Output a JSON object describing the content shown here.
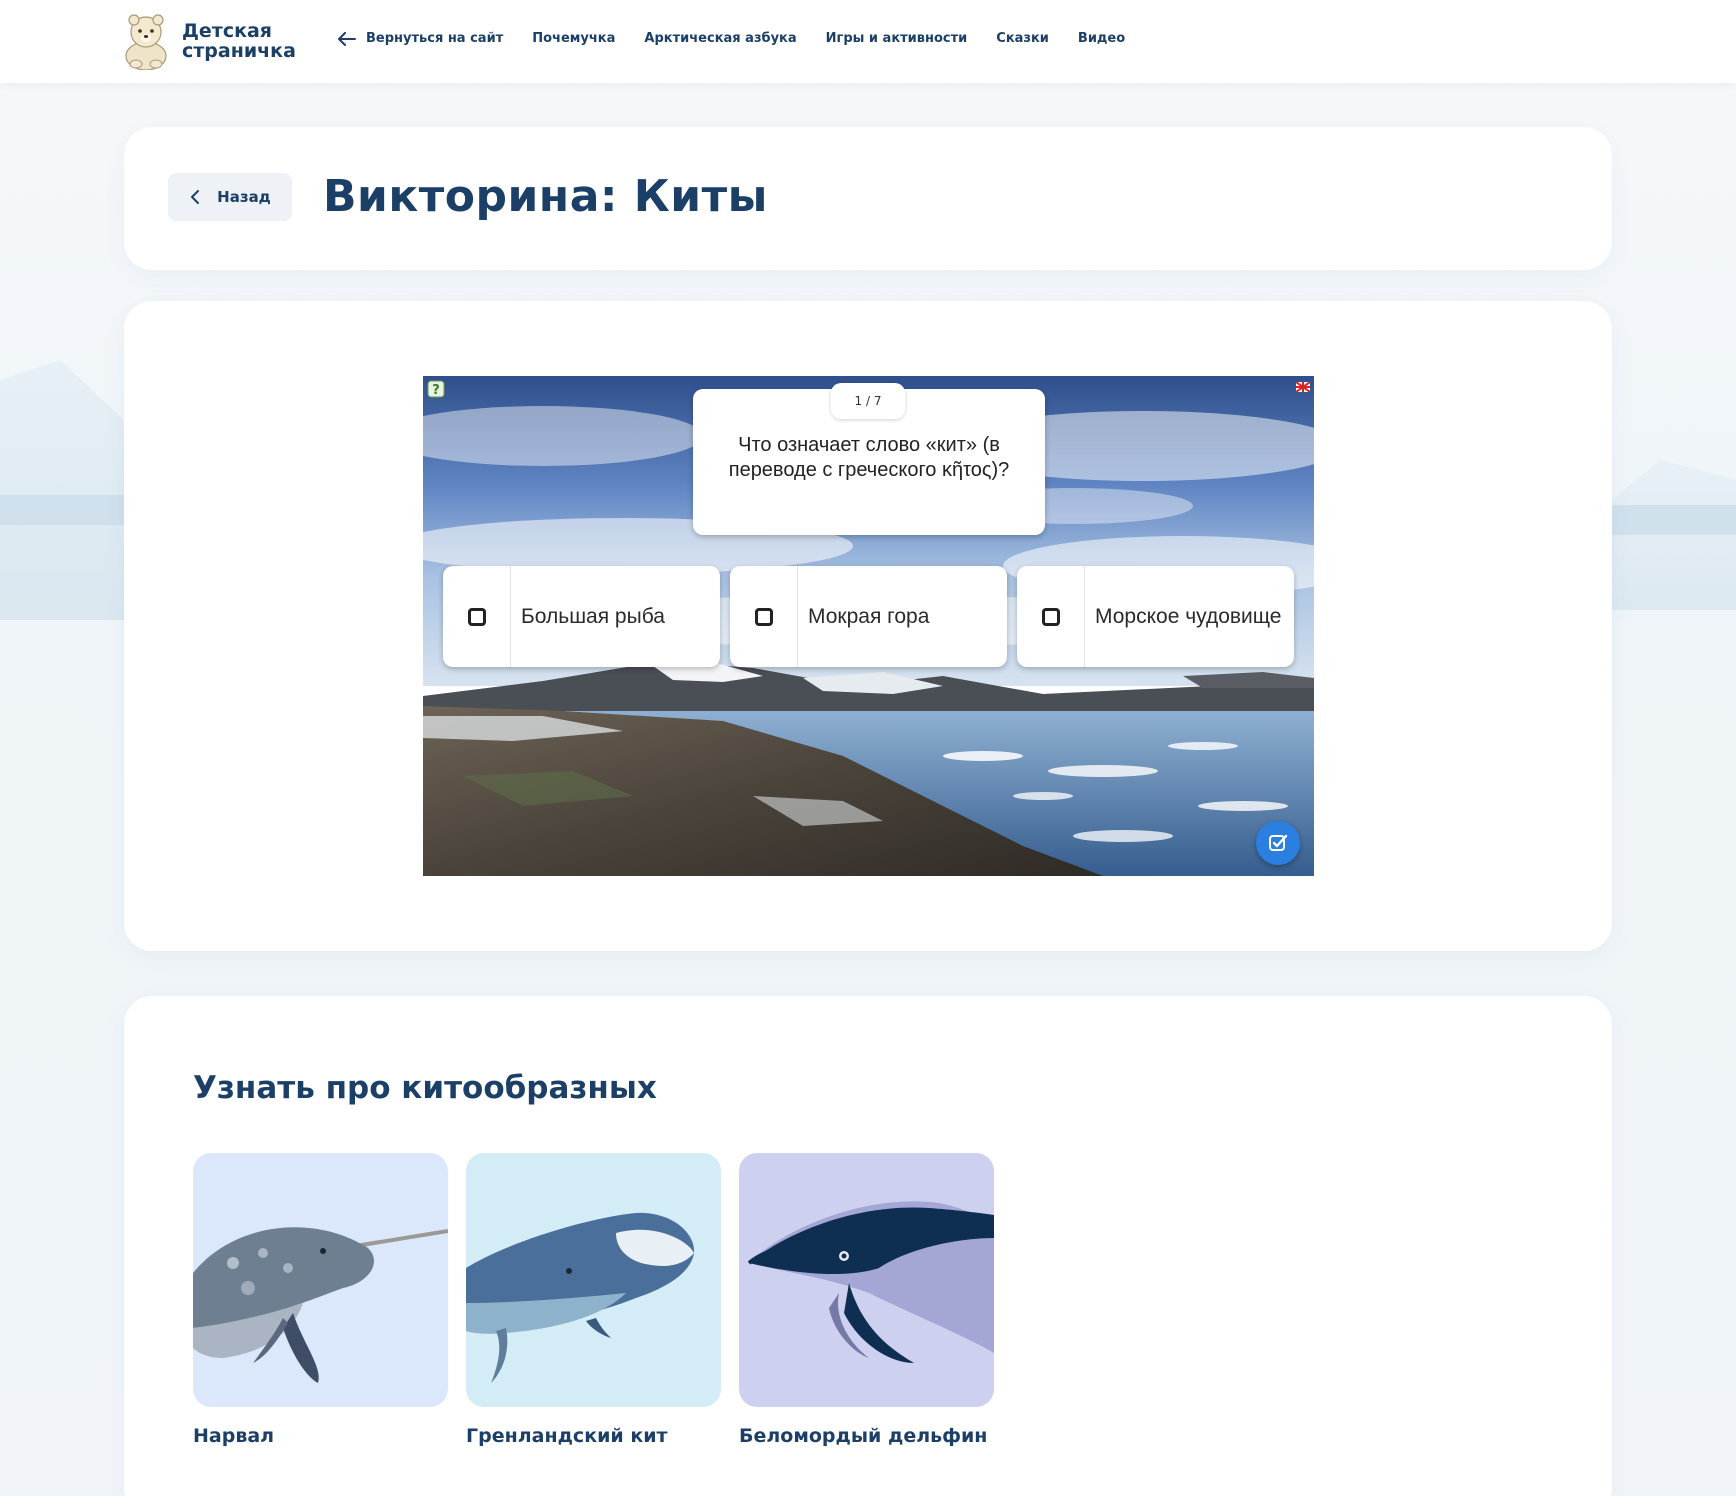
{
  "header": {
    "logo_line1": "Детская",
    "logo_line2": "страничка",
    "nav": [
      {
        "label": "Вернуться на сайт"
      },
      {
        "label": "Почемучка"
      },
      {
        "label": "Арктическая азбука"
      },
      {
        "label": "Игры и активности"
      },
      {
        "label": "Сказки"
      },
      {
        "label": "Видео"
      }
    ]
  },
  "title_card": {
    "back_label": "Назад",
    "title": "Викторина: Киты"
  },
  "quiz": {
    "counter": "1 / 7",
    "question": "Что означает слово «кит» (в переводе с греческого κῆτος)?",
    "answers": [
      {
        "label": "Большая рыба"
      },
      {
        "label": "Мокрая гора"
      },
      {
        "label": "Морское чудовище"
      }
    ]
  },
  "learn": {
    "title": "Узнать про китообразных",
    "items": [
      {
        "label": "Нарвал",
        "bg": "#dbe8fb"
      },
      {
        "label": "Гренландский кит",
        "bg": "#d3ecf6"
      },
      {
        "label": "Беломордый дельфин",
        "bg": "#cdd0ee"
      }
    ]
  },
  "colors": {
    "brand_navy": "#1b3f66",
    "submit_blue": "#2b7fe0"
  }
}
